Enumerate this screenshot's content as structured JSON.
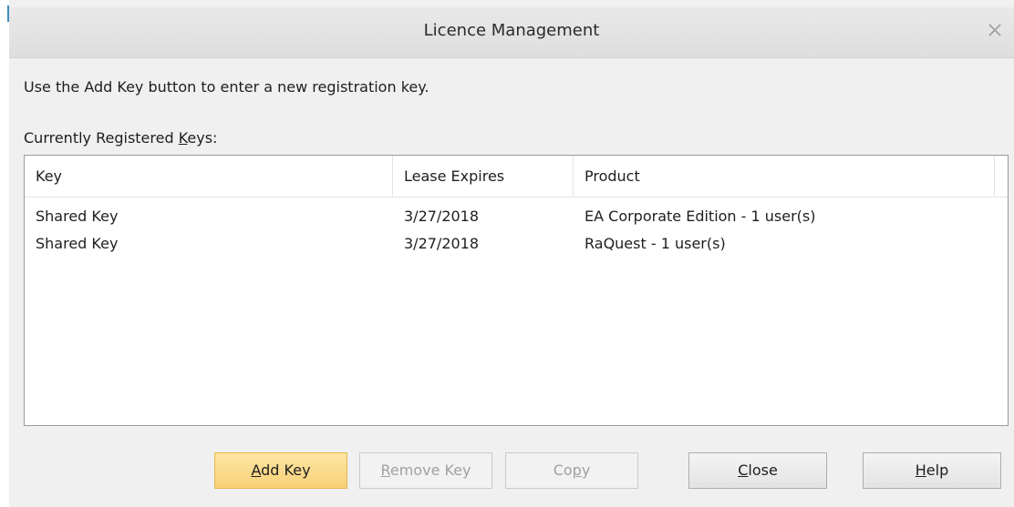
{
  "window": {
    "title": "Licence Management"
  },
  "instruction": "Use the Add Key button to enter a new registration key.",
  "keys_label": {
    "before": "Currently Registered ",
    "mnemonic": "K",
    "after": "eys:"
  },
  "table": {
    "columns": [
      "Key",
      "Lease Expires",
      "Product"
    ],
    "rows": [
      {
        "key": "Shared Key",
        "expires": "3/27/2018",
        "product": "EA Corporate Edition - 1 user(s)"
      },
      {
        "key": "Shared Key",
        "expires": "3/27/2018",
        "product": "RaQuest - 1 user(s)"
      }
    ]
  },
  "buttons": {
    "add_key": {
      "mnemonic": "A",
      "rest": "dd Key"
    },
    "remove_key": {
      "mnemonic": "R",
      "rest": "emove Key"
    },
    "copy": {
      "before": "Co",
      "mnemonic": "p",
      "after": "y"
    },
    "close": {
      "mnemonic": "C",
      "rest": "lose"
    },
    "help": {
      "mnemonic": "H",
      "rest": "elp"
    }
  },
  "icons": {
    "close": "close-icon"
  },
  "colors": {
    "primary_button": "#f8d178",
    "title_bar": "#e3e3e3",
    "dialog_bg": "#f0f0f0"
  }
}
